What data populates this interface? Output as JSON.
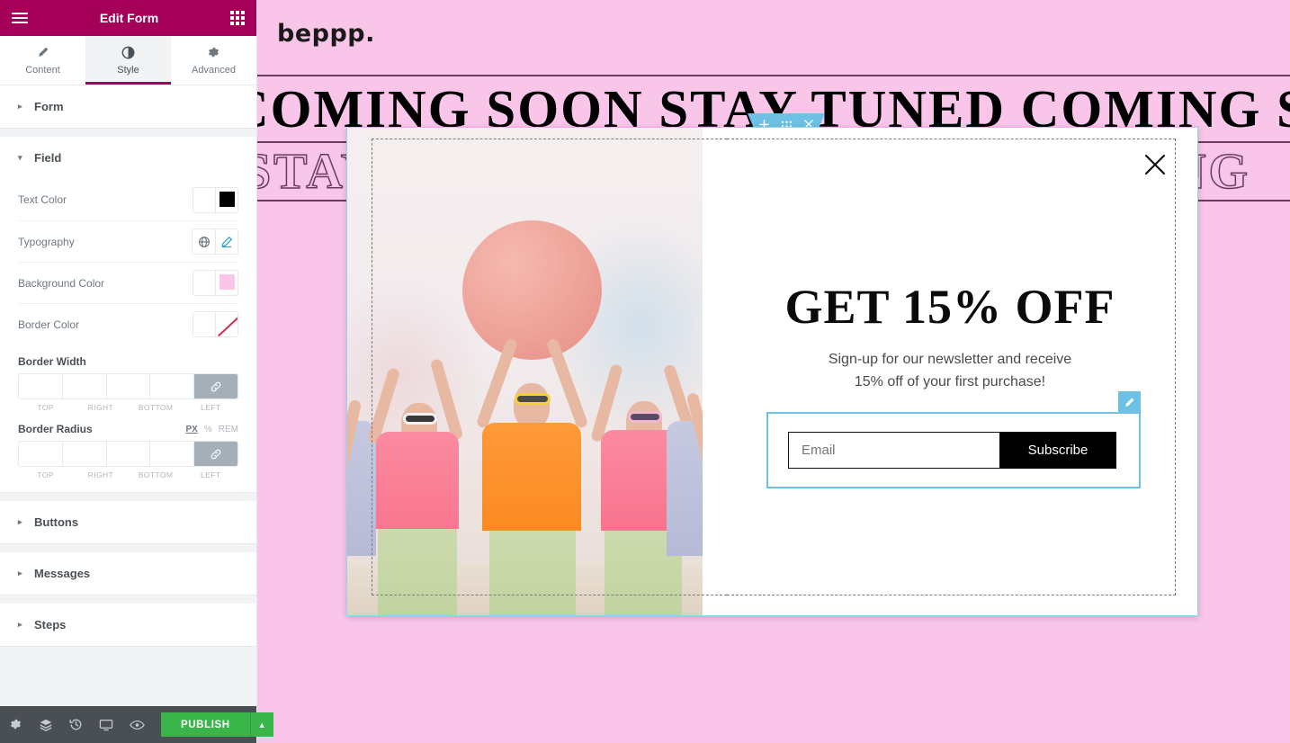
{
  "panel": {
    "header": {
      "title": "Edit Form",
      "menu_icon": "hamburger-icon",
      "widgets_icon": "grid-icon"
    },
    "tabs": [
      {
        "label": "Content",
        "icon": "pencil-icon",
        "active": false
      },
      {
        "label": "Style",
        "icon": "contrast-circle-icon",
        "active": true
      },
      {
        "label": "Advanced",
        "icon": "gear-icon",
        "active": false
      }
    ],
    "sections": [
      {
        "label": "Form",
        "expanded": false
      },
      {
        "label": "Field",
        "expanded": true
      },
      {
        "label": "Buttons",
        "expanded": false
      },
      {
        "label": "Messages",
        "expanded": false
      },
      {
        "label": "Steps",
        "expanded": false
      }
    ],
    "field_controls": {
      "text_color": {
        "label": "Text Color",
        "value": "#000000"
      },
      "typography": {
        "label": "Typography",
        "global_icon": "globe-icon",
        "edit_icon": "pencil-icon"
      },
      "background_color": {
        "label": "Background Color",
        "value": "#f9c6ea"
      },
      "border_color": {
        "label": "Border Color",
        "value": "none"
      },
      "border_width": {
        "label": "Border Width",
        "values": {
          "top": "",
          "right": "",
          "bottom": "",
          "left": ""
        },
        "sub_labels": {
          "top": "TOP",
          "right": "RIGHT",
          "bottom": "BOTTOM",
          "left": "LEFT"
        },
        "link_icon": "link-icon"
      },
      "border_radius": {
        "label": "Border Radius",
        "units": [
          "PX",
          "%",
          "REM"
        ],
        "active_unit": "PX",
        "values": {
          "top": "",
          "right": "",
          "bottom": "",
          "left": ""
        },
        "sub_labels": {
          "top": "TOP",
          "right": "RIGHT",
          "bottom": "BOTTOM",
          "left": "LEFT"
        },
        "link_icon": "link-icon"
      }
    },
    "footer": {
      "icons": [
        "gear-icon",
        "layers-icon",
        "history-icon",
        "responsive-monitor-icon",
        "eye-preview-icon"
      ],
      "publish_label": "PUBLISH",
      "publish_color": "#39b54a",
      "caret_icon": "chevron-up-icon"
    }
  },
  "canvas": {
    "background_color": "#f9c6ea",
    "logo": "beppp.",
    "marquee_solid": "COMING SOON STAY TUNED COMING SOON",
    "marquee_outline": "STAY TUNED COMING SOON COMING",
    "rule_color": "#6b3a5e"
  },
  "popup": {
    "close_icon": "close-x-icon",
    "column_handle_icon": "column-layout-icon",
    "section_toolbar": {
      "add_icon": "plus-icon",
      "drag_icon": "grip-dots-icon",
      "delete_icon": "close-x-icon",
      "color": "#6ec1e4"
    },
    "image_alt": "three women in colorful tops and sunglasses holding a large pink ball",
    "heading": "GET 15% OFF",
    "subtext_line1": "Sign-up for our newsletter and receive",
    "subtext_line2": "15% off of your first purchase!",
    "form": {
      "email_placeholder": "Email",
      "email_value": "",
      "submit_label": "Subscribe",
      "selected_outline_color": "#6ec1e4",
      "edit_badge_icon": "pencil-icon"
    }
  }
}
